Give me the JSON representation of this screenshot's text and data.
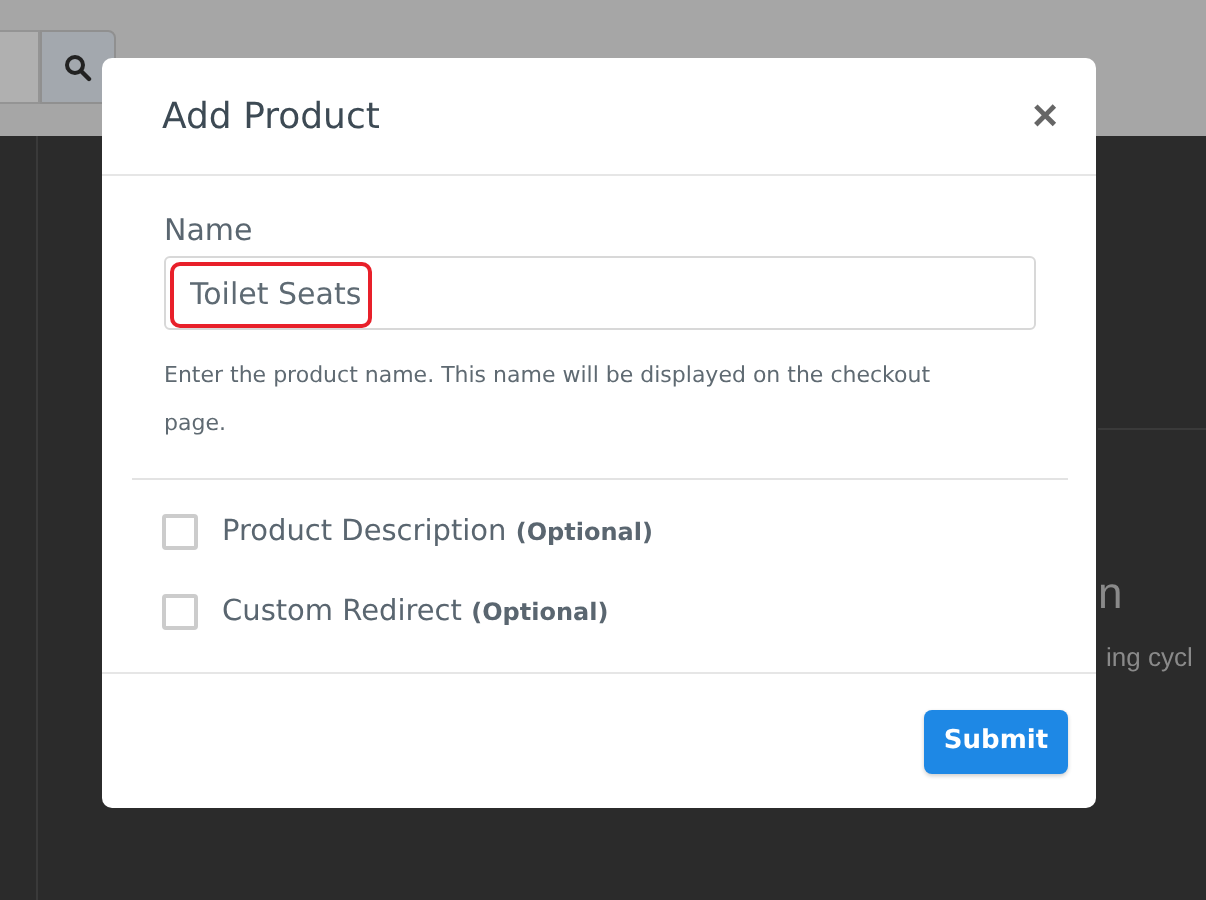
{
  "background": {
    "heading_fragment": "n",
    "text_fragment": "ing cycl"
  },
  "modal": {
    "title": "Add Product",
    "close": "×",
    "name_field": {
      "label": "Name",
      "value": "Toilet Seats",
      "highlighted": true,
      "help": "Enter the product name. This name will be displayed on the checkout page."
    },
    "options": [
      {
        "label": "Product Description",
        "note": "(Optional)",
        "checked": false
      },
      {
        "label": "Custom Redirect",
        "note": "(Optional)",
        "checked": false
      }
    ],
    "submit": "Submit"
  }
}
